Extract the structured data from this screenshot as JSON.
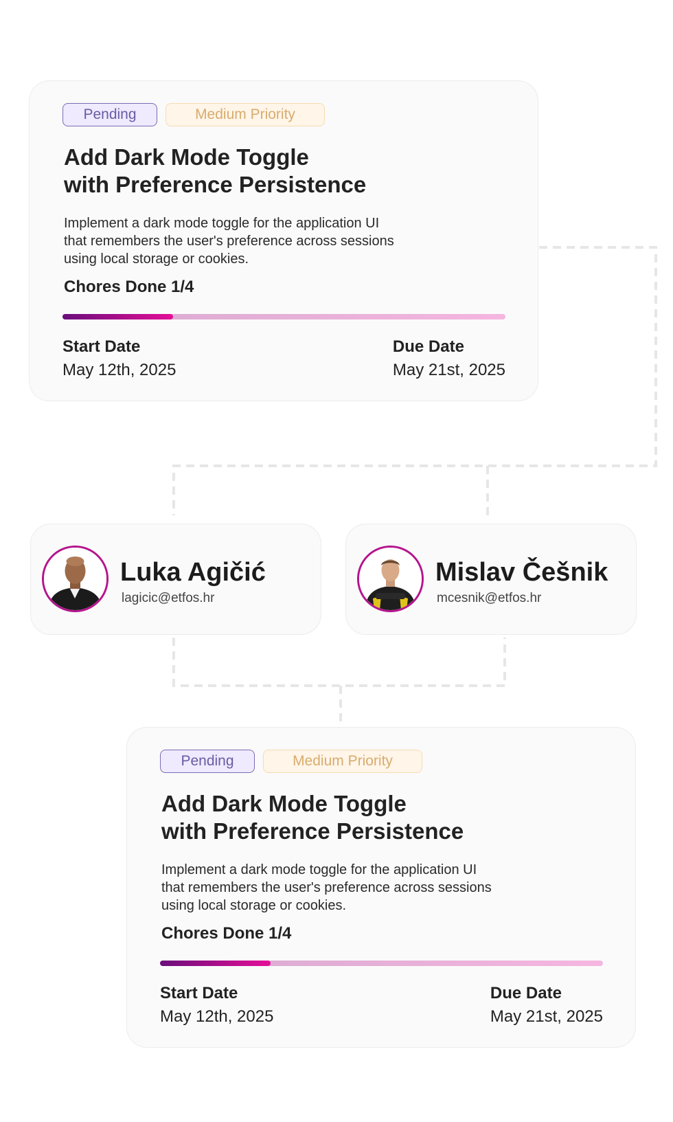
{
  "tasks": [
    {
      "status": "Pending",
      "priority": "Medium Priority",
      "title_line1": "Add Dark Mode Toggle",
      "title_line2": "with Preference Persistence",
      "description_line1": "Implement a dark mode toggle for the application UI",
      "description_line2": "that remembers the user's preference across sessions",
      "description_line3": "using local storage or cookies.",
      "chores_label": "Chores Done 1/4",
      "chores_done": 1,
      "chores_total": 4,
      "start_label": "Start Date",
      "start_value": "May 12th, 2025",
      "due_label": "Due Date",
      "due_value": "May 21st, 2025"
    },
    {
      "status": "Pending",
      "priority": "Medium Priority",
      "title_line1": "Add Dark Mode Toggle",
      "title_line2": "with Preference Persistence",
      "description_line1": "Implement a dark mode toggle for the application UI",
      "description_line2": "that remembers the user's preference across sessions",
      "description_line3": "using local storage or cookies.",
      "chores_label": "Chores Done 1/4",
      "chores_done": 1,
      "chores_total": 4,
      "start_label": "Start Date",
      "start_value": "May 12th, 2025",
      "due_label": "Due Date",
      "due_value": "May 21st, 2025"
    }
  ],
  "users": [
    {
      "name": "Luka Agičić",
      "email": "lagicic@etfos.hr"
    },
    {
      "name": "Mislav Češnik",
      "email": "mcesnik@etfos.hr"
    }
  ],
  "colors": {
    "status_border": "#7b6cb5",
    "priority_border": "#f6dcb2",
    "progress_fill_start": "#6a0e7b",
    "progress_fill_end": "#e40f97",
    "avatar_ring": "#b5148d",
    "connector": "#e6e6e6"
  }
}
